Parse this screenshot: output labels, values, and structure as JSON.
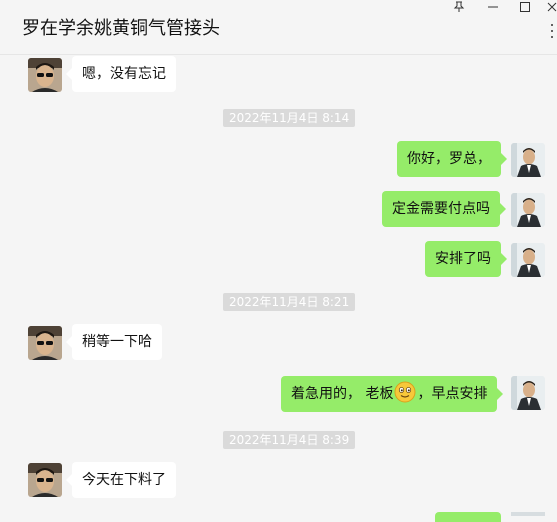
{
  "window": {
    "title": "罗在学余姚黄铜气管接头",
    "pin_icon": "pin-icon",
    "minimize_icon": "minimize-icon",
    "maximize_icon": "maximize-icon",
    "close_icon": "close-icon",
    "more_icon": "more-icon"
  },
  "messages": [
    {
      "side": "left",
      "text": "嗯，没有忘记"
    },
    {
      "type": "time",
      "text": "2022年11月4日 8:14"
    },
    {
      "side": "right",
      "text": "你好，罗总，"
    },
    {
      "side": "right",
      "text": "定金需要付点吗"
    },
    {
      "side": "right",
      "text": "安排了吗"
    },
    {
      "type": "time",
      "text": "2022年11月4日 8:21"
    },
    {
      "side": "left",
      "text": "稍等一下哈"
    },
    {
      "side": "right",
      "text_before": "着急用的， 老板",
      "emoji": "smile-emoji-icon",
      "text_after": "，早点安排"
    },
    {
      "type": "time",
      "text": "2022年11月4日 8:39"
    },
    {
      "side": "left",
      "text": "今天在下料了"
    }
  ],
  "colors": {
    "background": "#f5f5f5",
    "bubble_self": "#95ec69",
    "bubble_other": "#ffffff",
    "timestamp_bg": "#dadada"
  }
}
